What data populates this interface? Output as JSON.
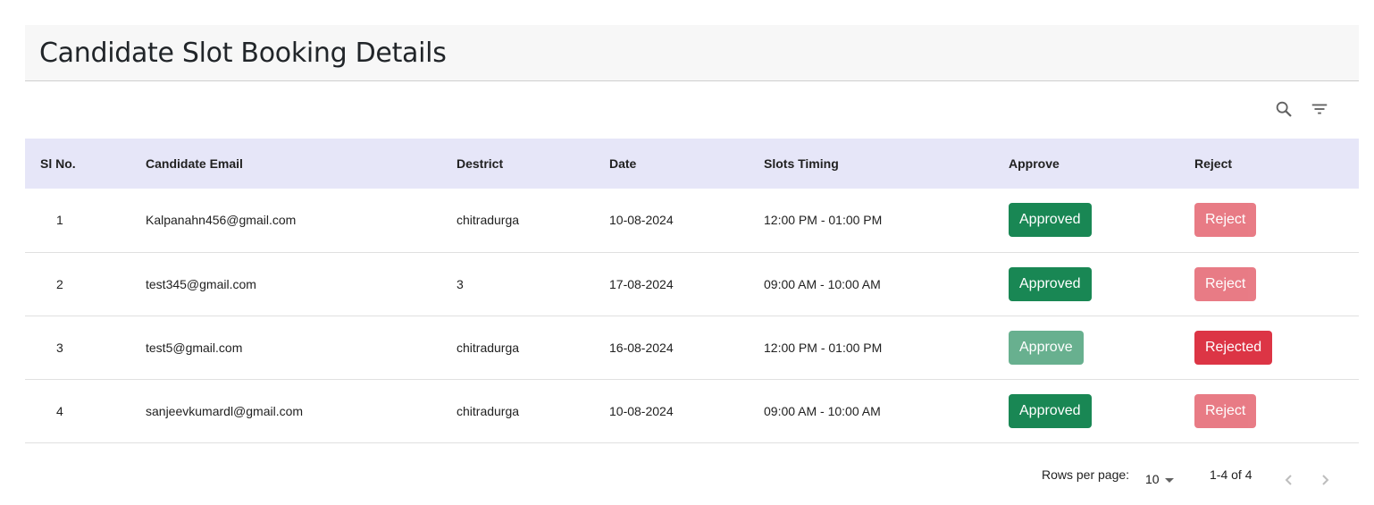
{
  "page": {
    "title": "Candidate Slot Booking Details"
  },
  "toolbar": {
    "search_icon": "search-icon",
    "filter_icon": "filter-list-icon"
  },
  "table": {
    "headers": [
      "Sl No.",
      "Candidate Email",
      "Destrict",
      "Date",
      "Slots Timing",
      "Approve",
      "Reject"
    ],
    "rows": [
      {
        "sl": "1",
        "email": "Kalpanahn456@gmail.com",
        "district": "chitradurga",
        "date": "10-08-2024",
        "slot": "12:00 PM - 01:00 PM",
        "approve": "Approved",
        "reject": "Reject",
        "approve_state": "active",
        "reject_state": "disabled"
      },
      {
        "sl": "2",
        "email": "test345@gmail.com",
        "district": "3",
        "date": "17-08-2024",
        "slot": "09:00 AM - 10:00 AM",
        "approve": "Approved",
        "reject": "Reject",
        "approve_state": "active",
        "reject_state": "disabled"
      },
      {
        "sl": "3",
        "email": "test5@gmail.com",
        "district": "chitradurga",
        "date": "16-08-2024",
        "slot": "12:00 PM - 01:00 PM",
        "approve": "Approve",
        "reject": "Rejected",
        "approve_state": "disabled",
        "reject_state": "active"
      },
      {
        "sl": "4",
        "email": "sanjeevkumardl@gmail.com",
        "district": "chitradurga",
        "date": "10-08-2024",
        "slot": "09:00 AM - 10:00 AM",
        "approve": "Approved",
        "reject": "Reject",
        "approve_state": "active",
        "reject_state": "disabled"
      }
    ]
  },
  "pagination": {
    "rows_per_page_label": "Rows per page:",
    "rows_per_page_value": "10",
    "range_text": "1-4 of 4"
  },
  "colors": {
    "header_bg": "#e6e6f8",
    "approve": "#198754",
    "reject": "#dc3545"
  }
}
